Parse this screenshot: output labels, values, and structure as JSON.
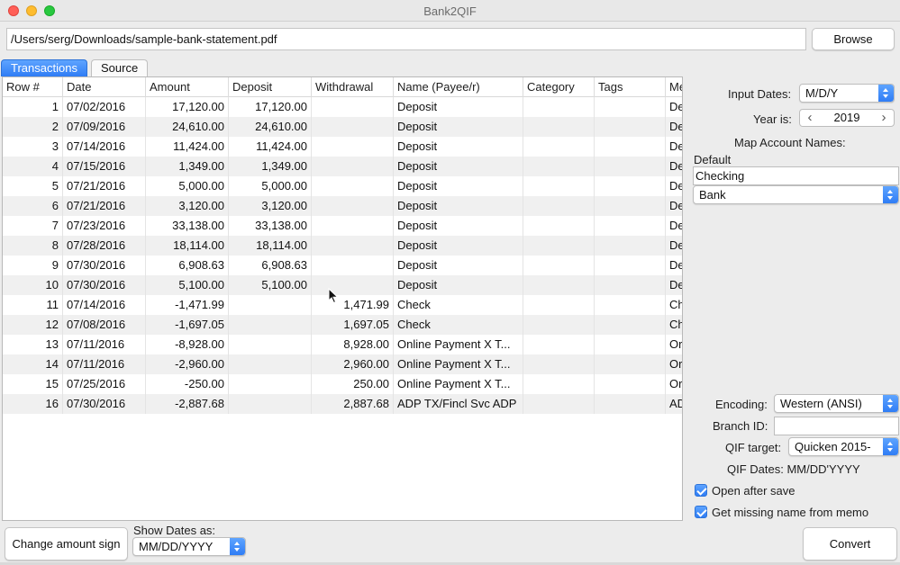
{
  "window": {
    "title": "Bank2QIF"
  },
  "file": {
    "path": "/Users/serg/Downloads/sample-bank-statement.pdf",
    "browse_label": "Browse"
  },
  "tabs": [
    {
      "label": "Transactions",
      "active": true
    },
    {
      "label": "Source",
      "active": false
    }
  ],
  "table": {
    "columns": [
      "Row #",
      "Date",
      "Amount",
      "Deposit",
      "Withdrawal",
      "Name (Payee/r)",
      "Category",
      "Tags",
      "Me"
    ],
    "rows": [
      [
        "1",
        "07/02/2016",
        "17,120.00",
        "17,120.00",
        "",
        "Deposit",
        "",
        "",
        "De"
      ],
      [
        "2",
        "07/09/2016",
        "24,610.00",
        "24,610.00",
        "",
        "Deposit",
        "",
        "",
        "De"
      ],
      [
        "3",
        "07/14/2016",
        "11,424.00",
        "11,424.00",
        "",
        "Deposit",
        "",
        "",
        "De"
      ],
      [
        "4",
        "07/15/2016",
        "1,349.00",
        "1,349.00",
        "",
        "Deposit",
        "",
        "",
        "De"
      ],
      [
        "5",
        "07/21/2016",
        "5,000.00",
        "5,000.00",
        "",
        "Deposit",
        "",
        "",
        "De"
      ],
      [
        "6",
        "07/21/2016",
        "3,120.00",
        "3,120.00",
        "",
        "Deposit",
        "",
        "",
        "De"
      ],
      [
        "7",
        "07/23/2016",
        "33,138.00",
        "33,138.00",
        "",
        "Deposit",
        "",
        "",
        "De"
      ],
      [
        "8",
        "07/28/2016",
        "18,114.00",
        "18,114.00",
        "",
        "Deposit",
        "",
        "",
        "De"
      ],
      [
        "9",
        "07/30/2016",
        "6,908.63",
        "6,908.63",
        "",
        "Deposit",
        "",
        "",
        "De"
      ],
      [
        "10",
        "07/30/2016",
        "5,100.00",
        "5,100.00",
        "",
        "Deposit",
        "",
        "",
        "De"
      ],
      [
        "11",
        "07/14/2016",
        "-1,471.99",
        "",
        "1,471.99",
        "Check",
        "",
        "",
        "Ch"
      ],
      [
        "12",
        "07/08/2016",
        "-1,697.05",
        "",
        "1,697.05",
        "Check",
        "",
        "",
        "Ch"
      ],
      [
        "13",
        "07/11/2016",
        "-8,928.00",
        "",
        "8,928.00",
        "Online Payment X T...",
        "",
        "",
        "Or"
      ],
      [
        "14",
        "07/11/2016",
        "-2,960.00",
        "",
        "2,960.00",
        "Online Payment X T...",
        "",
        "",
        "Or"
      ],
      [
        "15",
        "07/25/2016",
        "-250.00",
        "",
        "250.00",
        "Online Payment X T...",
        "",
        "",
        "Or"
      ],
      [
        "16",
        "07/30/2016",
        "-2,887.68",
        "",
        "2,887.68",
        "ADP TX/Fincl Svc ADP",
        "",
        "",
        "AD"
      ]
    ]
  },
  "settings": {
    "input_dates_label": "Input Dates:",
    "input_dates_value": "M/D/Y",
    "year_label": "Year is:",
    "year_value": "2019",
    "map_label": "Map Account Names:",
    "default_label": "Default",
    "account_name": "Checking",
    "account_type": "Bank",
    "encoding_label": "Encoding:",
    "encoding_value": "Western (ANSI)",
    "branch_label": "Branch ID:",
    "branch_value": "",
    "qif_target_label": "QIF target:",
    "qif_target_value": "Quicken 2015-",
    "qif_dates_text": "QIF Dates: MM/DD'YYYY",
    "open_after_save_label": "Open after save",
    "open_after_save": true,
    "missing_name_label": "Get missing name from memo",
    "missing_name": true
  },
  "bottom": {
    "change_sign_label": "Change amount sign",
    "show_dates_label": "Show Dates as:",
    "show_dates_value": "MM/DD/YYYY",
    "convert_label": "Convert"
  },
  "colors": {
    "accent": "#2f7df5",
    "row_alt": "#f0f0f0"
  }
}
